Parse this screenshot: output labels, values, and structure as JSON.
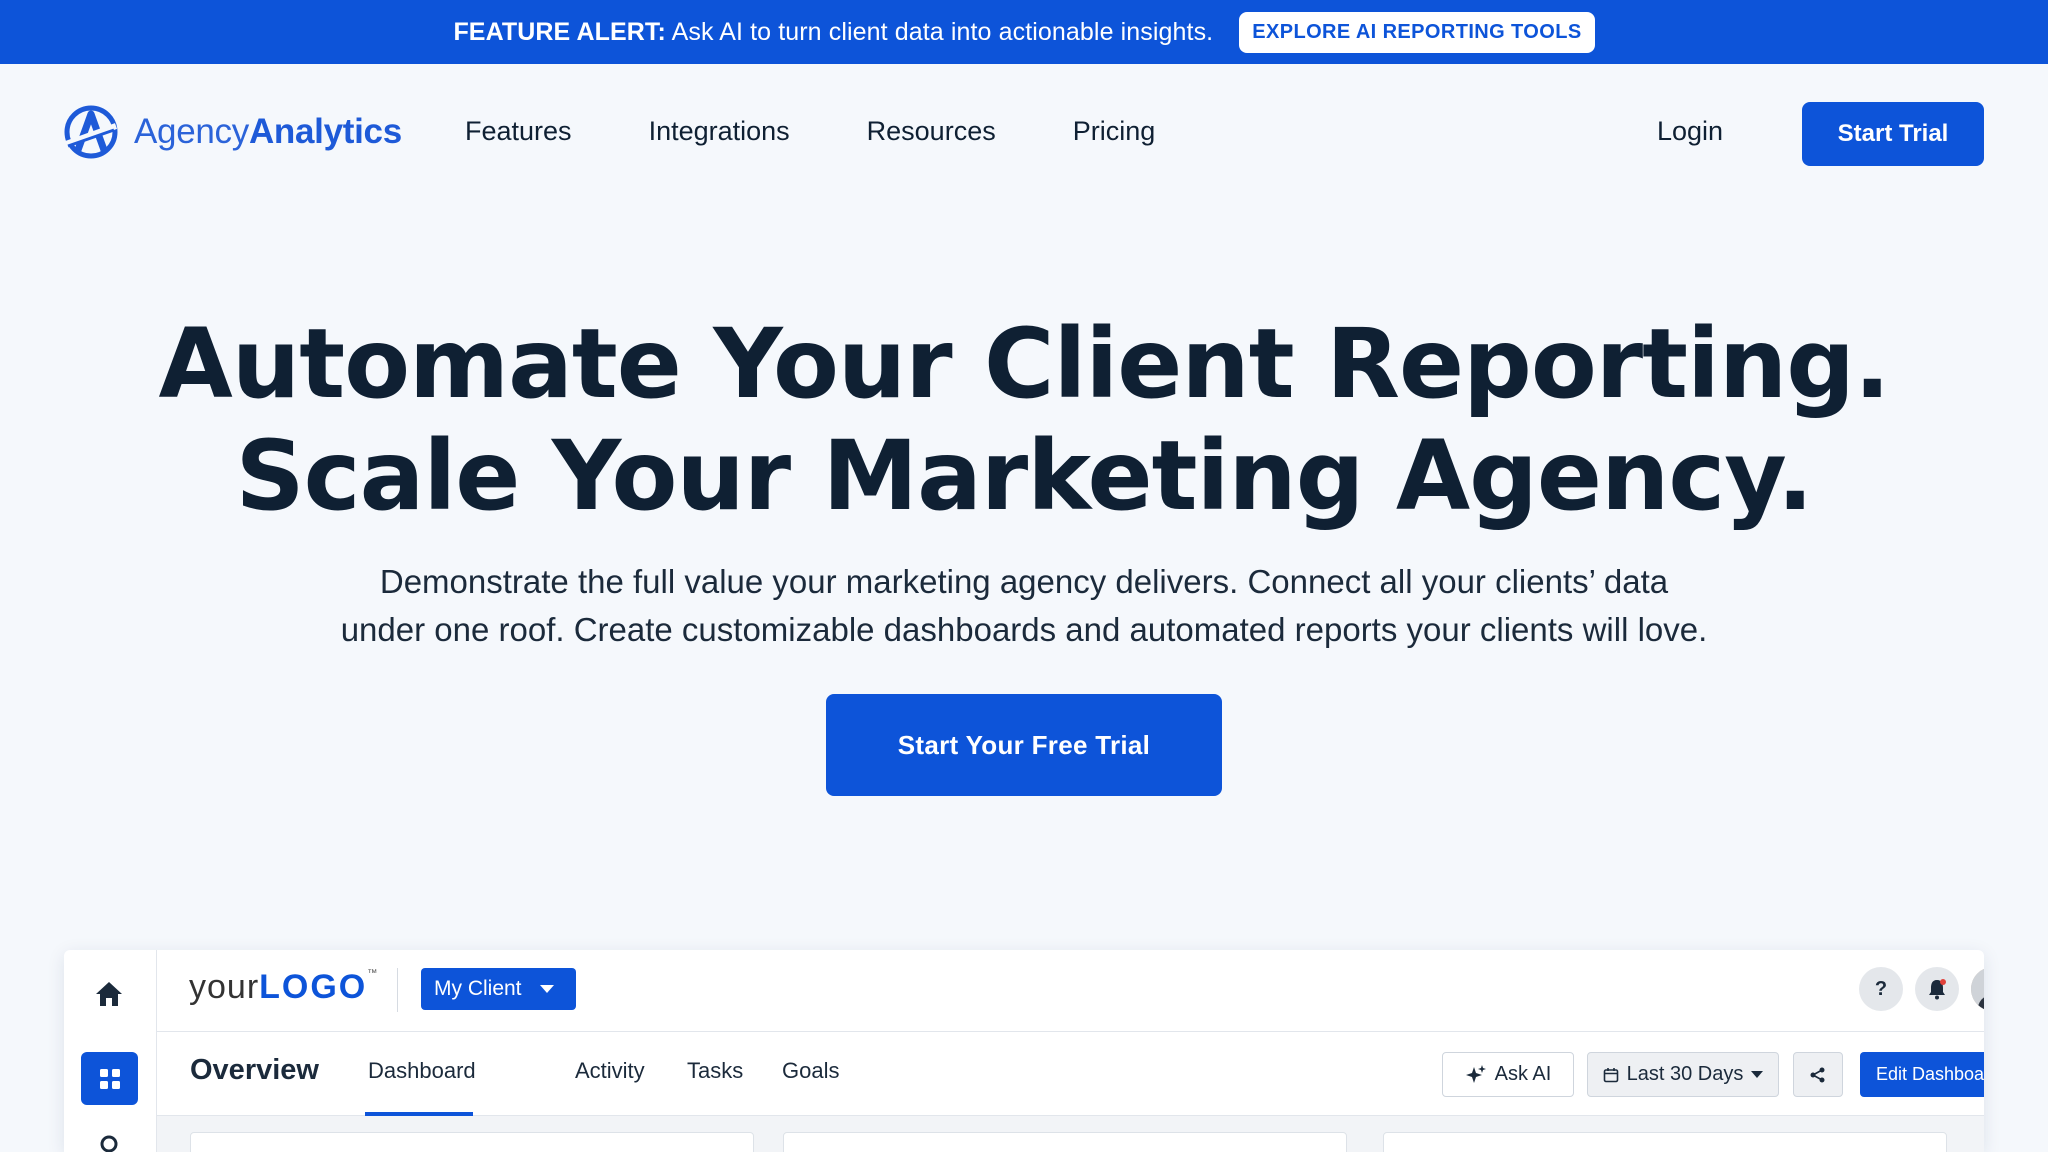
{
  "banner": {
    "prefix": "FEATURE ALERT:",
    "text": " Ask AI to turn client data into actionable insights.",
    "cta": "EXPLORE AI REPORTING TOOLS"
  },
  "nav": {
    "logo_light": "Agency",
    "logo_bold": "Analytics",
    "links": [
      "Features",
      "Integrations",
      "Resources",
      "Pricing"
    ],
    "login": "Login",
    "trial": "Start Trial"
  },
  "hero": {
    "title_line1": "Automate Your Client Reporting.",
    "title_line2": "Scale Your Marketing Agency.",
    "sub_line1": "Demonstrate the full value your marketing agency delivers. Connect all your clients’ data",
    "sub_line2": "under one roof. Create customizable dashboards and automated reports your clients will love.",
    "cta": "Start Your Free Trial"
  },
  "dashboard": {
    "logo_light": "your",
    "logo_bold": "LOGO",
    "logo_tm": "™",
    "client": "My Client",
    "help": "?",
    "title": "Overview",
    "tabs": [
      "Dashboard",
      "Activity",
      "Tasks",
      "Goals"
    ],
    "ask_ai": "Ask AI",
    "date_range": "Last 30 Days",
    "edit": "Edit Dashboard"
  },
  "colors": {
    "brand_blue": "#0d54d9",
    "text_dark": "#0f2033",
    "background": "#f5f8fc"
  }
}
